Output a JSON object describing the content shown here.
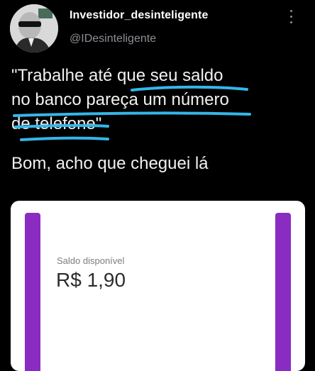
{
  "tweet": {
    "display_name": "Investidor_desinteligente",
    "handle": "@IDesinteligente",
    "text_lines": [
      "\"Trabalhe até que seu saldo",
      "no banco pareça um número",
      "de telefone\""
    ],
    "reply_text": "Bom, acho que cheguei lá"
  },
  "card": {
    "label": "Saldo disponível",
    "value": "R$ 1,90"
  },
  "icons": {
    "more": "more-vertical-icon",
    "avatar": "avatar-image"
  },
  "colors": {
    "background": "#000000",
    "text": "#f1f1f1",
    "handle": "#8b8f94",
    "highlight": "#35b6e8",
    "accent_purple": "#8a2bc2",
    "card": "#ffffff"
  }
}
